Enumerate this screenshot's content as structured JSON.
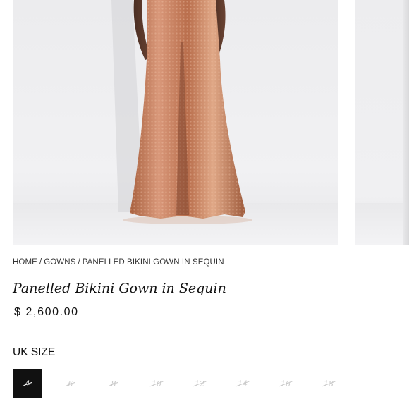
{
  "breadcrumb": {
    "items": [
      "HOME",
      "GOWNS",
      "PANELLED BIKINI GOWN IN SEQUIN"
    ],
    "separator": "/"
  },
  "product": {
    "title": "Panelled Bikini Gown in Sequin",
    "price": "$ 2,600.00"
  },
  "size_selector": {
    "label": "UK SIZE",
    "options": [
      "4",
      "6",
      "8",
      "10",
      "12",
      "14",
      "16",
      "18"
    ],
    "selected": "4",
    "selected_color": "#111111",
    "unavailable_color": "#c9c9c9"
  },
  "gallery": {
    "gown_color": "#c8865f",
    "background_color": "#eeeef0"
  }
}
